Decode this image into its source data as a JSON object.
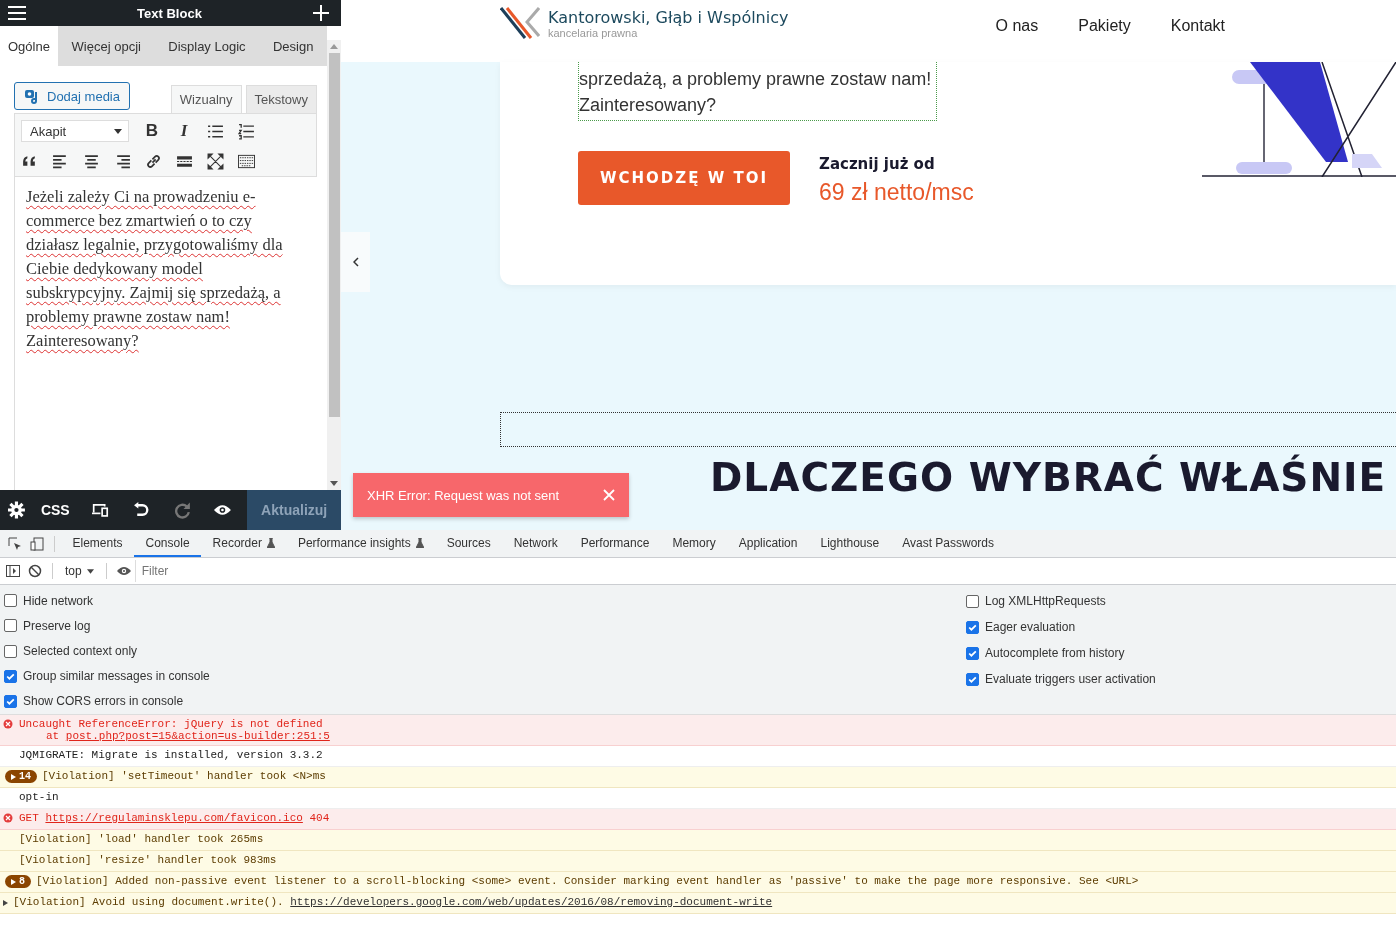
{
  "editor": {
    "title": "Text Block",
    "tabs": [
      {
        "label": "Ogólne",
        "selected": true
      },
      {
        "label": "Więcej opcji",
        "selected": false
      },
      {
        "label": "Display Logic",
        "selected": false
      },
      {
        "label": "Design",
        "selected": false
      }
    ],
    "add_media": "Dodaj media",
    "mode_tabs": [
      {
        "label": "Wizualny",
        "selected": true
      },
      {
        "label": "Tekstowy",
        "selected": false
      }
    ],
    "format_select": "Akapit",
    "text_buttons": [
      "B",
      "I"
    ],
    "content": "Jeżeli zależy Ci na prowadzeniu e-commerce bez zmartwień o to czy działasz legalnie, przygotowaliśmy dla Ciebie dedykowany model subskrypcyjny. Zajmij się sprzedażą, a problemy prawne zostaw nam! Zainteresowany?",
    "css_label": "CSS",
    "update": "Aktualizuj"
  },
  "site": {
    "logo_name": "Kantorowski, Głąb i Wspólnicy",
    "logo_tagline": "kancelaria prawna",
    "nav": [
      "O nas",
      "Pakiety",
      "Kontakt"
    ],
    "hero_lines": [
      "sprzedażą, a problemy prawne zostaw nam!",
      "Zainteresowany?"
    ],
    "cta": "WCHODZĘ W TOI",
    "price_label": "Zacznij już od",
    "price": "69 zł netto/msc",
    "heading": "DLACZEGO WYBRAĆ WŁAŚNIE"
  },
  "toast": {
    "message": "XHR Error: Request was not sent"
  },
  "devtools": {
    "tabs": [
      {
        "label": "Elements",
        "selected": false,
        "experimental": false
      },
      {
        "label": "Console",
        "selected": true,
        "experimental": false
      },
      {
        "label": "Recorder",
        "selected": false,
        "experimental": true
      },
      {
        "label": "Performance insights",
        "selected": false,
        "experimental": true
      },
      {
        "label": "Sources",
        "selected": false,
        "experimental": false
      },
      {
        "label": "Network",
        "selected": false,
        "experimental": false
      },
      {
        "label": "Performance",
        "selected": false,
        "experimental": false
      },
      {
        "label": "Memory",
        "selected": false,
        "experimental": false
      },
      {
        "label": "Application",
        "selected": false,
        "experimental": false
      },
      {
        "label": "Lighthouse",
        "selected": false,
        "experimental": false
      },
      {
        "label": "Avast Passwords",
        "selected": false,
        "experimental": false
      }
    ],
    "context": "top",
    "filter_placeholder": "Filter",
    "settings_left": [
      {
        "label": "Hide network",
        "checked": false
      },
      {
        "label": "Preserve log",
        "checked": false
      },
      {
        "label": "Selected context only",
        "checked": false
      },
      {
        "label": "Group similar messages in console",
        "checked": true
      },
      {
        "label": "Show CORS errors in console",
        "checked": true
      }
    ],
    "settings_right": [
      {
        "label": "Log XMLHttpRequests",
        "checked": false
      },
      {
        "label": "Eager evaluation",
        "checked": true
      },
      {
        "label": "Autocomplete from history",
        "checked": true
      },
      {
        "label": "Evaluate triggers user activation",
        "checked": true
      }
    ],
    "messages": [
      {
        "kind": "error",
        "text": "Uncaught ReferenceError: jQuery is not defined",
        "trace_prefix": "at",
        "trace_link": "post.php?post=15&action=us-builder:251:5"
      },
      {
        "kind": "log",
        "text": "JQMIGRATE: Migrate is installed, version 3.3.2"
      },
      {
        "kind": "warning",
        "count": "14",
        "text": "[Violation] 'setTimeout' handler took <N>ms"
      },
      {
        "kind": "log",
        "text": "opt-in"
      },
      {
        "kind": "error",
        "text": "GET",
        "link": "https://regulaminsklepu.com/favicon.ico",
        "suffix": "404"
      },
      {
        "kind": "warning",
        "text": "[Violation] 'load' handler took 265ms"
      },
      {
        "kind": "warning",
        "text": "[Violation] 'resize' handler took 983ms"
      },
      {
        "kind": "warning",
        "count": "8",
        "text": "[Violation] Added non-passive event listener to a scroll-blocking <some> event. Consider marking event handler as 'passive' to make the page more responsive. See <URL>"
      },
      {
        "kind": "warning",
        "expandable": true,
        "text": "[Violation] Avoid using document.write().",
        "link": "https://developers.google.com/web/updates/2016/08/removing-document-write"
      }
    ]
  }
}
